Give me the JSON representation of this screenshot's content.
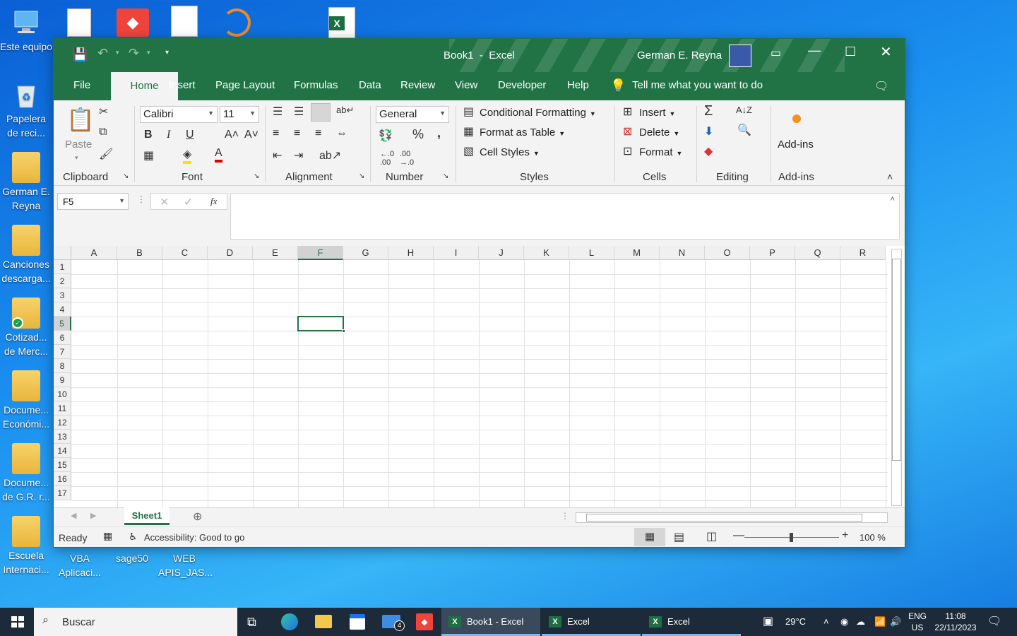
{
  "desktop": {
    "icons": [
      {
        "label": "Este equipo"
      },
      {
        "label": "Papelera de reci..."
      },
      {
        "label": "German E. Reyna"
      },
      {
        "label": "Canciones descarga..."
      },
      {
        "label": "Cotizad... de Merc..."
      },
      {
        "label": "Docume... Económi..."
      },
      {
        "label": "Docume... de G.R. r..."
      },
      {
        "label": "Escuela Internaci..."
      },
      {
        "label": "VBA Aplicaci..."
      },
      {
        "label": "sage50"
      },
      {
        "label": "WEB APIS_JAS..."
      }
    ]
  },
  "window": {
    "title": "Book1  -  Excel",
    "user": "German E. Reyna",
    "accent": "#217346"
  },
  "tabs": [
    "File",
    "Home",
    "Insert",
    "Page Layout",
    "Formulas",
    "Data",
    "Review",
    "View",
    "Developer",
    "Help"
  ],
  "tellme": "Tell me what you want to do",
  "ribbon": {
    "clipboard": {
      "paste": "Paste",
      "label": "Clipboard"
    },
    "font": {
      "name": "Calibri",
      "size": "11",
      "label": "Font"
    },
    "alignment": {
      "label": "Alignment"
    },
    "number": {
      "format": "General",
      "label": "Number",
      "percent": "%",
      "comma": ","
    },
    "styles": {
      "cond": "Conditional Formatting",
      "table": "Format as Table",
      "cell": "Cell Styles",
      "label": "Styles"
    },
    "cells": {
      "insert": "Insert",
      "delete": "Delete",
      "format": "Format",
      "label": "Cells"
    },
    "editing": {
      "label": "Editing"
    },
    "addins": {
      "button": "Add-ins",
      "label": "Add-ins"
    }
  },
  "formula_bar": {
    "name_box": "F5",
    "fx": "fx",
    "value": ""
  },
  "grid": {
    "columns": [
      "A",
      "B",
      "C",
      "D",
      "E",
      "F",
      "G",
      "H",
      "I",
      "J",
      "K",
      "L",
      "M",
      "N",
      "O",
      "P",
      "Q",
      "R"
    ],
    "rows": [
      "1",
      "2",
      "3",
      "4",
      "5",
      "6",
      "7",
      "8",
      "9",
      "10",
      "11",
      "12",
      "13",
      "14",
      "15",
      "16",
      "17"
    ],
    "selected_cell": "F5"
  },
  "sheet_tabs": [
    "Sheet1"
  ],
  "status": {
    "ready": "Ready",
    "accessibility": "Accessibility: Good to go",
    "zoom": "100 %"
  },
  "taskbar": {
    "search": "Buscar",
    "mail_badge": "4",
    "apps": [
      "Book1 - Excel",
      "Excel",
      "Excel"
    ],
    "weather": "29°C",
    "lang1": "ENG",
    "lang2": "US",
    "time": "11:08",
    "date": "22/11/2023"
  }
}
